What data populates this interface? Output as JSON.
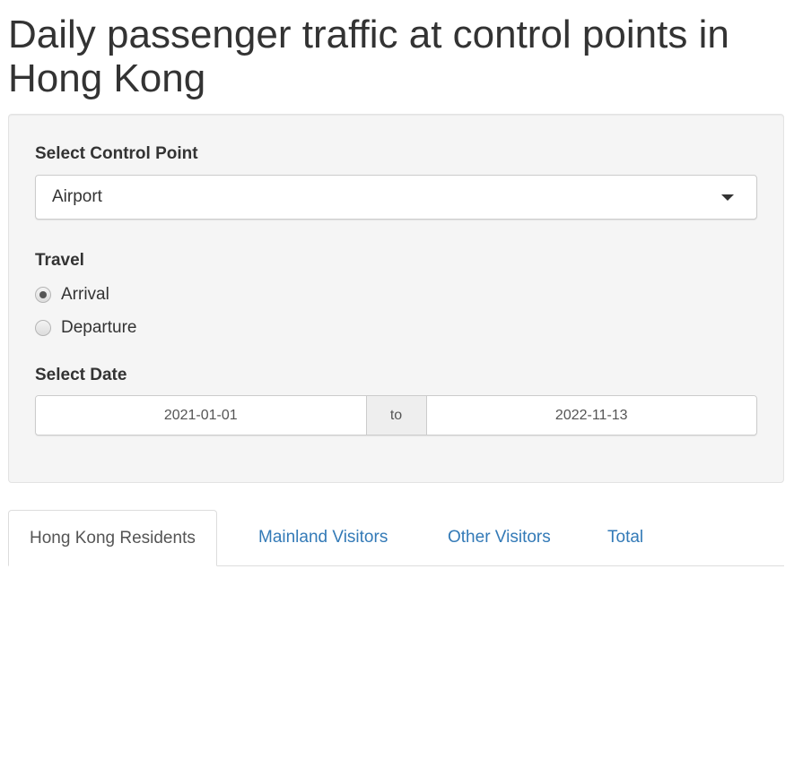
{
  "page": {
    "title": "Daily passenger traffic at control points in Hong Kong"
  },
  "controls": {
    "control_point": {
      "label": "Select Control Point",
      "selected": "Airport"
    },
    "travel": {
      "label": "Travel",
      "options": [
        {
          "label": "Arrival",
          "checked": true
        },
        {
          "label": "Departure",
          "checked": false
        }
      ]
    },
    "date": {
      "label": "Select Date",
      "start": "2021-01-01",
      "separator": "to",
      "end": "2022-11-13"
    }
  },
  "tabs": [
    {
      "label": "Hong Kong Residents",
      "active": true
    },
    {
      "label": "Mainland Visitors",
      "active": false
    },
    {
      "label": "Other Visitors",
      "active": false
    },
    {
      "label": "Total",
      "active": false
    }
  ],
  "colors": {
    "link": "#337ab7",
    "well_bg": "#f5f5f5",
    "text": "#333333"
  }
}
